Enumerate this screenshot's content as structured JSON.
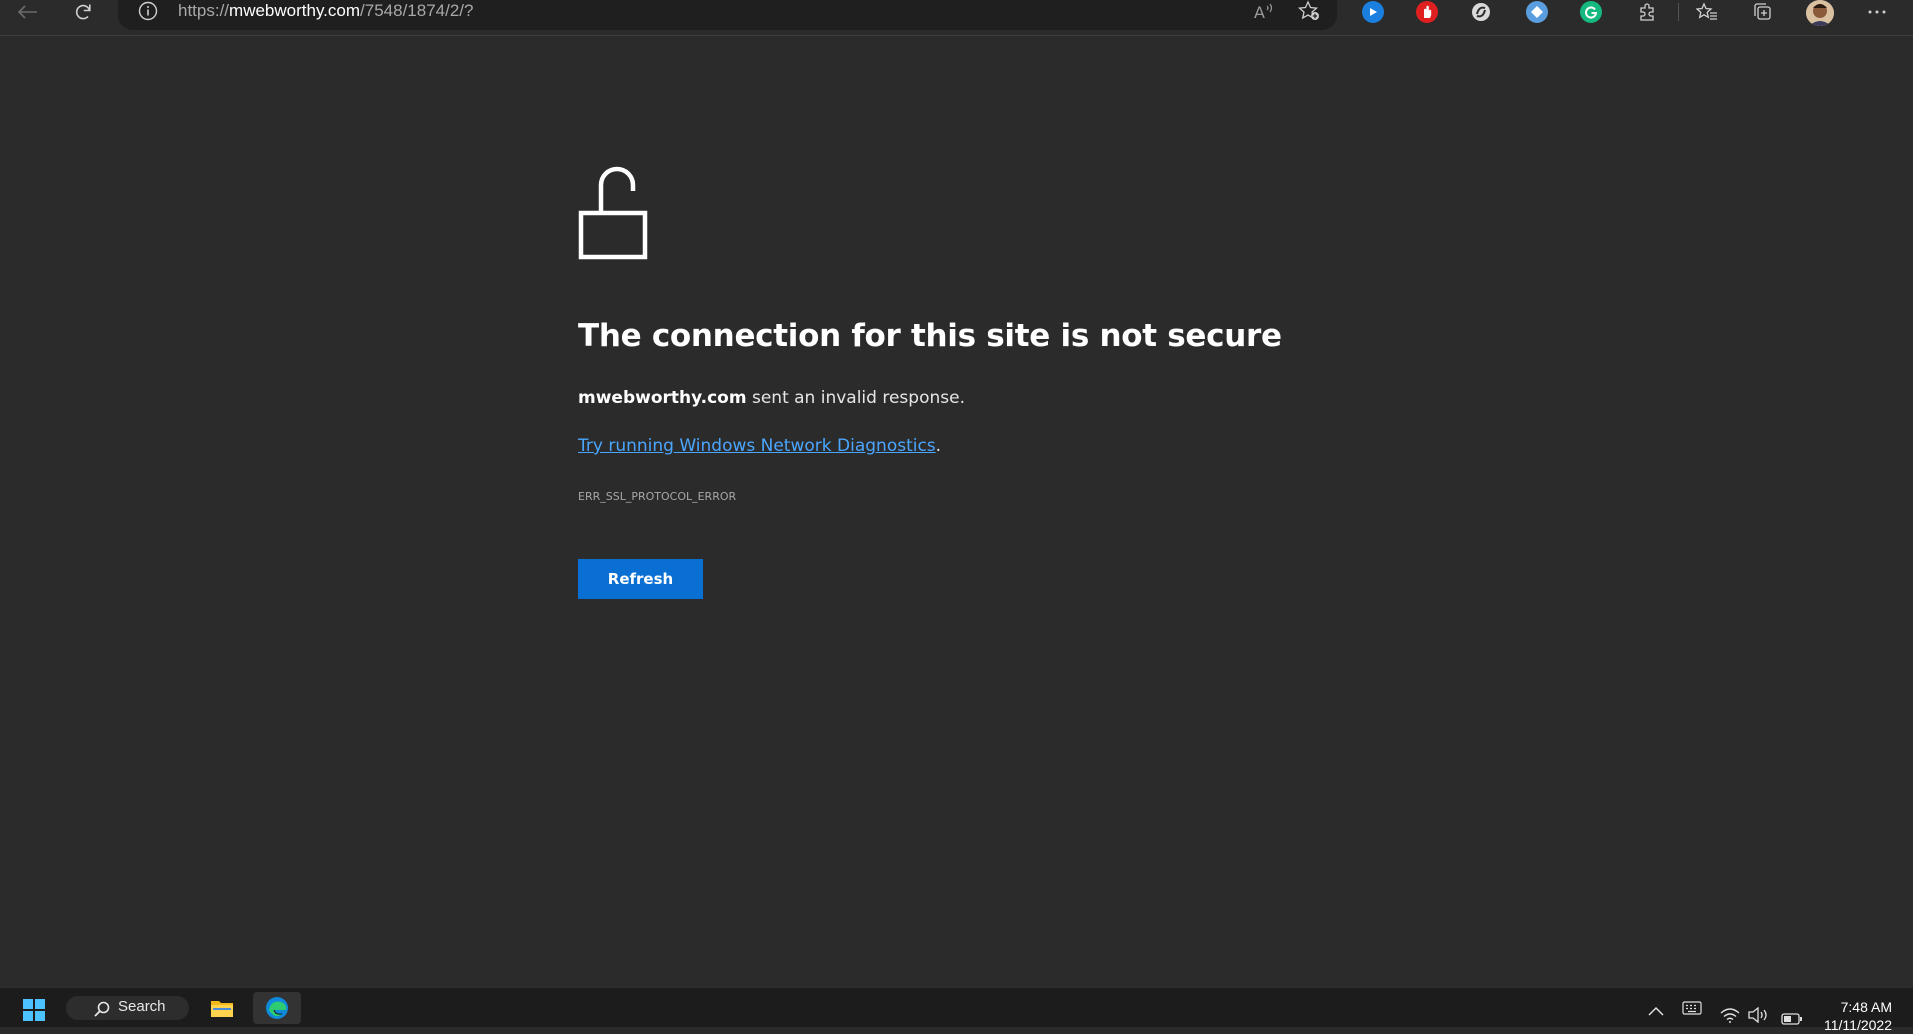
{
  "browser": {
    "url_scheme": "https://",
    "url_host": "mwebworthy.com",
    "url_path": "/7548/1874/2/?"
  },
  "error_page": {
    "headline": "The connection for this site is not secure",
    "site_host": "mwebworthy.com",
    "description_suffix": " sent an invalid response.",
    "diagnostics_link": "Try running Windows Network Diagnostics",
    "diagnostics_suffix": ".",
    "error_code": "ERR_SSL_PROTOCOL_ERROR",
    "refresh_label": "Refresh"
  },
  "taskbar": {
    "search_label": "Search",
    "time": "7:48 AM",
    "date": "11/11/2022"
  },
  "colors": {
    "page_background": "#2b2b2b",
    "link": "#4aa6ff",
    "button": "#0a6fd3"
  },
  "icons": {
    "back": "back-arrow-icon",
    "refresh": "refresh-icon",
    "site_info": "info-icon",
    "read_aloud": "read-aloud-icon",
    "favorite": "add-favorite-icon",
    "error": "unlocked-padlock-icon"
  }
}
